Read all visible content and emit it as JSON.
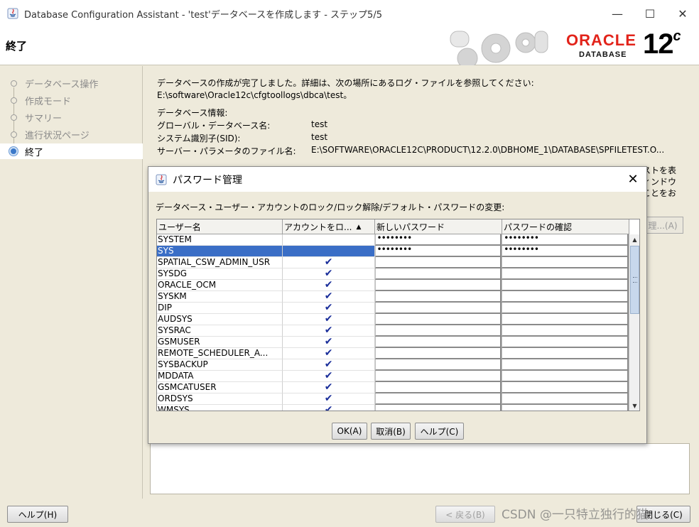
{
  "window": {
    "title": "Database Configuration Assistant - 'test'データベースを作成します - ステップ5/5",
    "page_heading": "終了",
    "minimize_glyph": "—",
    "maximize_glyph": "☐",
    "close_glyph": "✕"
  },
  "logo": {
    "brand": "ORACLE",
    "product": "DATABASE",
    "version": "12",
    "version_suffix": "c"
  },
  "nav": {
    "items": [
      {
        "label": "データベース操作",
        "active": false
      },
      {
        "label": "作成モード",
        "active": false
      },
      {
        "label": "サマリー",
        "active": false
      },
      {
        "label": "進行状況ページ",
        "active": false
      },
      {
        "label": "終了",
        "active": true
      }
    ]
  },
  "main": {
    "complete_message": "データベースの作成が完了しました。詳細は、次の場所にあるログ・ファイルを参照してください:",
    "log_path": "E:\\software\\Oracle12c\\cfgtoollogs\\dbca\\test。",
    "info_heading": "データベース情報:",
    "global_db_name_label": "グローバル・データベース名:",
    "global_db_name_value": "test",
    "sid_label": "システム識別子(SID):",
    "sid_value": "test",
    "spfile_label": "サーバー・パラメータのファイル名:",
    "spfile_value": "E:\\SOFTWARE\\ORACLE12C\\PRODUCT\\12.2.0\\DBHOME_1\\DATABASE\\SPFILETEST.O...",
    "side_fragment_1": "ストを表",
    "side_fragment_2": "ィンドウ",
    "side_fragment_3": "ことをお",
    "side_button_fragment": "理...(A)"
  },
  "dialog": {
    "title": "パスワード管理",
    "close_glyph": "✕",
    "description": "データベース・ユーザー・アカウントのロック/ロック解除/デフォルト・パスワードの変更:",
    "columns": [
      "ユーザー名",
      "アカウントをロ...",
      "新しいパスワード",
      "パスワードの確認"
    ],
    "sort_glyph": "▲",
    "rows": [
      {
        "user": "SYSTEM",
        "locked": "",
        "new_pw": "••••••••",
        "confirm_pw": "••••••••"
      },
      {
        "user": "SYS",
        "locked": "",
        "new_pw": "••••••••",
        "confirm_pw": "••••••••"
      },
      {
        "user": "SPATIAL_CSW_ADMIN_USR",
        "locked": "✔",
        "new_pw": "",
        "confirm_pw": ""
      },
      {
        "user": "SYSDG",
        "locked": "✔",
        "new_pw": "",
        "confirm_pw": ""
      },
      {
        "user": "ORACLE_OCM",
        "locked": "✔",
        "new_pw": "",
        "confirm_pw": ""
      },
      {
        "user": "SYSKM",
        "locked": "✔",
        "new_pw": "",
        "confirm_pw": ""
      },
      {
        "user": "DIP",
        "locked": "✔",
        "new_pw": "",
        "confirm_pw": ""
      },
      {
        "user": "AUDSYS",
        "locked": "✔",
        "new_pw": "",
        "confirm_pw": ""
      },
      {
        "user": "SYSRAC",
        "locked": "✔",
        "new_pw": "",
        "confirm_pw": ""
      },
      {
        "user": "GSMUSER",
        "locked": "✔",
        "new_pw": "",
        "confirm_pw": ""
      },
      {
        "user": "REMOTE_SCHEDULER_A...",
        "locked": "✔",
        "new_pw": "",
        "confirm_pw": ""
      },
      {
        "user": "SYSBACKUP",
        "locked": "✔",
        "new_pw": "",
        "confirm_pw": ""
      },
      {
        "user": "MDDATA",
        "locked": "✔",
        "new_pw": "",
        "confirm_pw": ""
      },
      {
        "user": "GSMCATUSER",
        "locked": "✔",
        "new_pw": "",
        "confirm_pw": ""
      },
      {
        "user": "ORDSYS",
        "locked": "✔",
        "new_pw": "",
        "confirm_pw": ""
      },
      {
        "user": "WMSYS",
        "locked": "✔",
        "new_pw": "",
        "confirm_pw": ""
      }
    ],
    "scroll_up_glyph": "▲",
    "scroll_down_glyph": "▼",
    "ok_label": "OK(A)",
    "cancel_label": "取消(B)",
    "help_label": "ヘルプ(C)"
  },
  "footer": {
    "help_label": "ヘルプ(H)",
    "back_label": "< 戻る(B)",
    "close_label": "閉じる(C)",
    "watermark": "CSDN @一只特立独行的猫"
  },
  "colors": {
    "oracle_red": "#e2231a",
    "selection": "#3a6ec6",
    "check": "#1a2e9a",
    "background": "#eeeadb"
  }
}
